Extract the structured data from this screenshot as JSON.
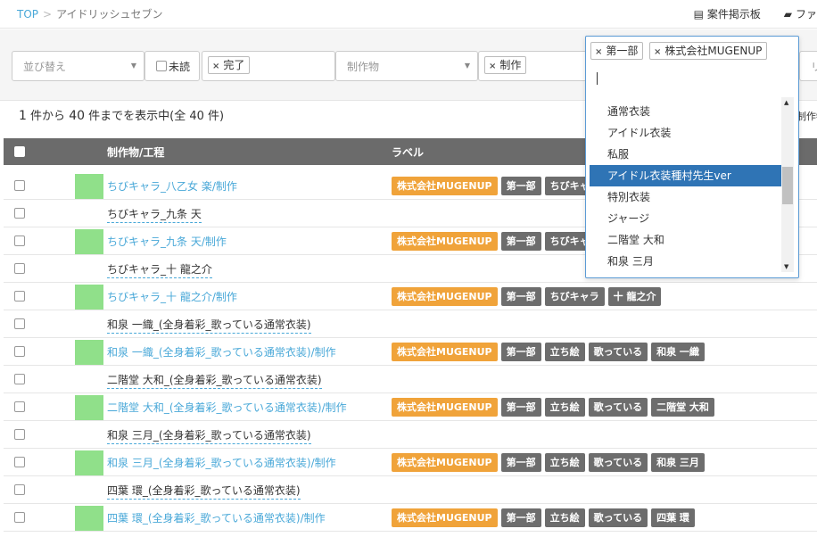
{
  "breadcrumb": {
    "top": "TOP",
    "sep": ">",
    "current": "アイドリッシュセブン"
  },
  "toplinks": [
    {
      "icon": "board-icon",
      "glyph": "▤",
      "label": "案件掲示板"
    },
    {
      "icon": "folder-icon",
      "glyph": "▰",
      "label": "ファ"
    }
  ],
  "filters": {
    "sort_placeholder": "並び替え",
    "unread_label": "未読",
    "status_chip": "完了",
    "product_placeholder": "制作物",
    "process_chip": "制作",
    "right_stub": "リ"
  },
  "labels_dropdown": {
    "chips": [
      "第一部",
      "株式会社MUGENUP"
    ],
    "options": [
      "通常衣装",
      "アイドル衣装",
      "私服",
      "アイドル衣装種村先生ver",
      "特別衣装",
      "ジャージ",
      "二階堂 大和",
      "和泉 三月"
    ],
    "highlighted_index": 3
  },
  "result_count": {
    "from": "1",
    "to": "40",
    "text_mid": " 件から ",
    "text_end": " 件までを表示中(全 40 件)"
  },
  "right_stub": "制作物",
  "table": {
    "col_product": "制作物/工程",
    "col_label": "ラベル",
    "rows": [
      {
        "type": "child",
        "title": "ちびキャラ_八乙女 楽/制作",
        "labels": [
          "株式会社MUGENUP",
          "第一部",
          "ちびキャラ"
        ]
      },
      {
        "type": "parent",
        "title": "ちびキャラ_九条 天",
        "labels": []
      },
      {
        "type": "child",
        "title": "ちびキャラ_九条 天/制作",
        "labels": [
          "株式会社MUGENUP",
          "第一部",
          "ちびキャラ"
        ]
      },
      {
        "type": "parent",
        "title": "ちびキャラ_十 龍之介",
        "labels": []
      },
      {
        "type": "child",
        "title": "ちびキャラ_十 龍之介/制作",
        "labels": [
          "株式会社MUGENUP",
          "第一部",
          "ちびキャラ",
          "十 龍之介"
        ]
      },
      {
        "type": "parent",
        "title": "和泉 一織_(全身着彩_歌っている通常衣装)",
        "labels": []
      },
      {
        "type": "child",
        "title": "和泉 一織_(全身着彩_歌っている通常衣装)/制作",
        "labels": [
          "株式会社MUGENUP",
          "第一部",
          "立ち絵",
          "歌っている",
          "和泉 一織"
        ]
      },
      {
        "type": "parent",
        "title": "二階堂 大和_(全身着彩_歌っている通常衣装)",
        "labels": []
      },
      {
        "type": "child",
        "title": "二階堂 大和_(全身着彩_歌っている通常衣装)/制作",
        "labels": [
          "株式会社MUGENUP",
          "第一部",
          "立ち絵",
          "歌っている",
          "二階堂 大和"
        ]
      },
      {
        "type": "parent",
        "title": "和泉 三月_(全身着彩_歌っている通常衣装)",
        "labels": []
      },
      {
        "type": "child",
        "title": "和泉 三月_(全身着彩_歌っている通常衣装)/制作",
        "labels": [
          "株式会社MUGENUP",
          "第一部",
          "立ち絵",
          "歌っている",
          "和泉 三月"
        ]
      },
      {
        "type": "parent",
        "title": "四葉 環_(全身着彩_歌っている通常衣装)",
        "labels": []
      },
      {
        "type": "child",
        "title": "四葉 環_(全身着彩_歌っている通常衣装)/制作",
        "labels": [
          "株式会社MUGENUP",
          "第一部",
          "立ち絵",
          "歌っている",
          "四葉 環"
        ]
      }
    ]
  },
  "colors": {
    "accent": "#49a8d8",
    "org_tag": "#f0a33a",
    "tag": "#6d6d6d",
    "swatch": "#90e08a",
    "header": "#6b6b6b",
    "highlight": "#2f74b5"
  }
}
